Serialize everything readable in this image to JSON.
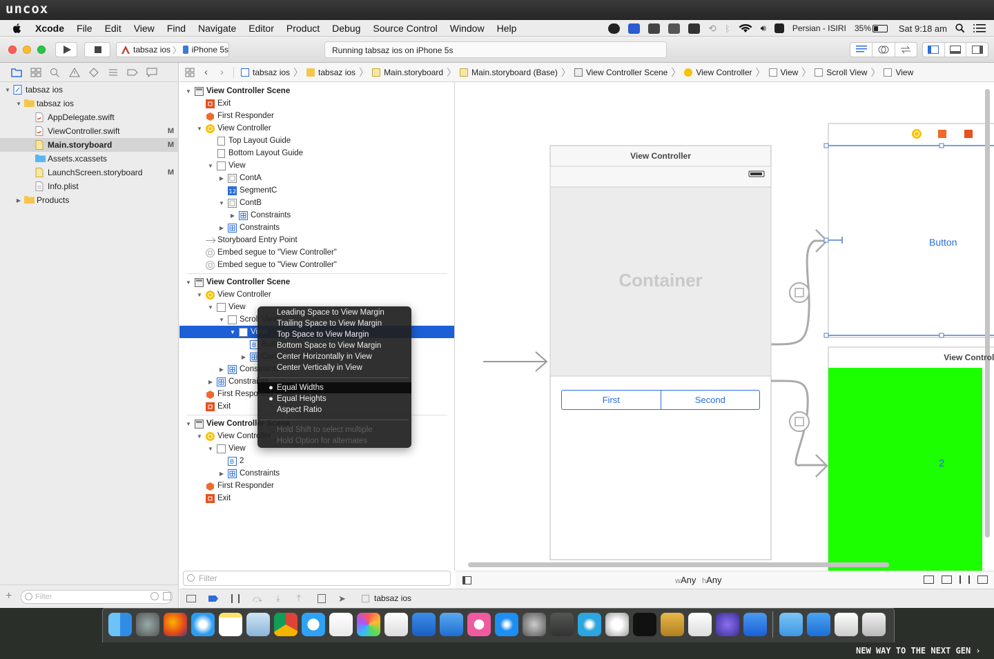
{
  "brand": {
    "logo": "uncox",
    "tagline": "NEW WAY TO THE NEXT GEN ›"
  },
  "menubar": {
    "app": "Xcode",
    "items": [
      "File",
      "Edit",
      "View",
      "Find",
      "Navigate",
      "Editor",
      "Product",
      "Debug",
      "Source Control",
      "Window",
      "Help"
    ],
    "input_source": "Persian - ISIRI",
    "battery": "35%",
    "clock": "Sat 9:18 am"
  },
  "toolbar": {
    "scheme": "tabsaz ios",
    "device": "iPhone 5s",
    "status": "Running tabsaz ios on iPhone 5s"
  },
  "navigator": {
    "files": [
      {
        "name": "tabsaz ios",
        "depth": 0,
        "tri": "▼",
        "icon": "project-icon",
        "badge": ""
      },
      {
        "name": "tabsaz ios",
        "depth": 1,
        "tri": "▼",
        "icon": "folder-icon",
        "badge": ""
      },
      {
        "name": "AppDelegate.swift",
        "depth": 2,
        "tri": "",
        "icon": "swift-file-icon",
        "badge": ""
      },
      {
        "name": "ViewController.swift",
        "depth": 2,
        "tri": "",
        "icon": "swift-file-icon",
        "badge": "M"
      },
      {
        "name": "Main.storyboard",
        "depth": 2,
        "tri": "",
        "icon": "storyboard-file-icon",
        "badge": "M",
        "selected": true
      },
      {
        "name": "Assets.xcassets",
        "depth": 2,
        "tri": "",
        "icon": "assets-folder-icon",
        "badge": ""
      },
      {
        "name": "LaunchScreen.storyboard",
        "depth": 2,
        "tri": "",
        "icon": "storyboard-file-icon",
        "badge": "M"
      },
      {
        "name": "Info.plist",
        "depth": 2,
        "tri": "",
        "icon": "plist-file-icon",
        "badge": ""
      },
      {
        "name": "Products",
        "depth": 1,
        "tri": "▶",
        "icon": "folder-icon",
        "badge": ""
      }
    ],
    "filter_placeholder": "Filter"
  },
  "jumpbar": [
    "tabsaz ios",
    "tabsaz ios",
    "Main.storyboard",
    "Main.storyboard (Base)",
    "View Controller Scene",
    "View Controller",
    "View",
    "Scroll View",
    "View"
  ],
  "outline": {
    "rows": [
      {
        "t": "View Controller Scene",
        "d": 0,
        "tri": "▼",
        "icon": "scene",
        "scene": true
      },
      {
        "t": "Exit",
        "d": 1,
        "tri": "",
        "icon": "exit"
      },
      {
        "t": "First Responder",
        "d": 1,
        "tri": "",
        "icon": "responder"
      },
      {
        "t": "View Controller",
        "d": 1,
        "tri": "▼",
        "icon": "vc"
      },
      {
        "t": "Top Layout Guide",
        "d": 2,
        "tri": "",
        "icon": "guide"
      },
      {
        "t": "Bottom Layout Guide",
        "d": 2,
        "tri": "",
        "icon": "guide"
      },
      {
        "t": "View",
        "d": 2,
        "tri": "▼",
        "icon": "view"
      },
      {
        "t": "ContA",
        "d": 3,
        "tri": "▶",
        "icon": "container"
      },
      {
        "t": "SegmentC",
        "d": 3,
        "tri": "",
        "icon": "segment"
      },
      {
        "t": "ContB",
        "d": 3,
        "tri": "▼",
        "icon": "container"
      },
      {
        "t": "Constraints",
        "d": 4,
        "tri": "▶",
        "icon": "constraints"
      },
      {
        "t": "Constraints",
        "d": 3,
        "tri": "▶",
        "icon": "constraints"
      },
      {
        "t": "Storyboard Entry Point",
        "d": 1,
        "tri": "",
        "icon": "arrow"
      },
      {
        "t": "Embed segue to \"View Controller\"",
        "d": 1,
        "tri": "",
        "icon": "segue"
      },
      {
        "t": "Embed segue to \"View Controller\"",
        "d": 1,
        "tri": "",
        "icon": "segue"
      },
      {
        "divider": true
      },
      {
        "t": "View Controller Scene",
        "d": 0,
        "tri": "▼",
        "icon": "scene",
        "scene": true
      },
      {
        "t": "View Controller",
        "d": 1,
        "tri": "▼",
        "icon": "vc"
      },
      {
        "t": "View",
        "d": 2,
        "tri": "▼",
        "icon": "view"
      },
      {
        "t": "Scroll View",
        "d": 3,
        "tri": "▼",
        "icon": "view"
      },
      {
        "t": "View",
        "d": 4,
        "tri": "▼",
        "icon": "view",
        "sel": true
      },
      {
        "t": "Button",
        "d": 5,
        "tri": "",
        "icon": "button"
      },
      {
        "t": "Constraints",
        "d": 5,
        "tri": "▶",
        "icon": "constraints"
      },
      {
        "t": "Constraints",
        "d": 3,
        "tri": "▶",
        "icon": "constraints"
      },
      {
        "t": "Constraints",
        "d": 2,
        "tri": "▶",
        "icon": "constraints"
      },
      {
        "t": "First Responder",
        "d": 1,
        "tri": "",
        "icon": "responder"
      },
      {
        "t": "Exit",
        "d": 1,
        "tri": "",
        "icon": "exit"
      },
      {
        "divider": true
      },
      {
        "t": "View Controller Scene",
        "d": 0,
        "tri": "▼",
        "icon": "scene",
        "scene": true
      },
      {
        "t": "View Controller",
        "d": 1,
        "tri": "▼",
        "icon": "vc"
      },
      {
        "t": "View",
        "d": 2,
        "tri": "▼",
        "icon": "view"
      },
      {
        "t": "2",
        "d": 3,
        "tri": "",
        "icon": "button"
      },
      {
        "t": "Constraints",
        "d": 3,
        "tri": "▶",
        "icon": "constraints"
      },
      {
        "t": "First Responder",
        "d": 1,
        "tri": "",
        "icon": "responder"
      },
      {
        "t": "Exit",
        "d": 1,
        "tri": "",
        "icon": "exit"
      }
    ],
    "filter_placeholder": "Filter"
  },
  "popup": {
    "items": [
      "Leading Space to View Margin",
      "Trailing Space to View Margin",
      "Top Space to View Margin",
      "Bottom Space to View Margin",
      "Center Horizontally in View",
      "Center Vertically in View"
    ],
    "size_items": [
      {
        "t": "Equal Widths",
        "dot": "●",
        "hl": true
      },
      {
        "t": "Equal Heights",
        "dot": "●",
        "hl": false
      },
      {
        "t": "Aspect Ratio",
        "dot": "",
        "hl": false
      }
    ],
    "hints": [
      "Hold Shift to select multiple",
      "Hold Option for alternates"
    ]
  },
  "canvas": {
    "main_vc_title": "View Controller",
    "container_label": "Container",
    "segment": [
      "First",
      "Second"
    ],
    "button_label": "Button",
    "child_vc_title": "View Controller",
    "child_label": "2",
    "size_class": {
      "w": "w",
      "w_val": "Any",
      "h": "h",
      "h_val": "Any"
    },
    "green": "#1cff00",
    "accent": "#1c5fd7"
  },
  "bottombar": {
    "target": "tabsaz ios"
  }
}
